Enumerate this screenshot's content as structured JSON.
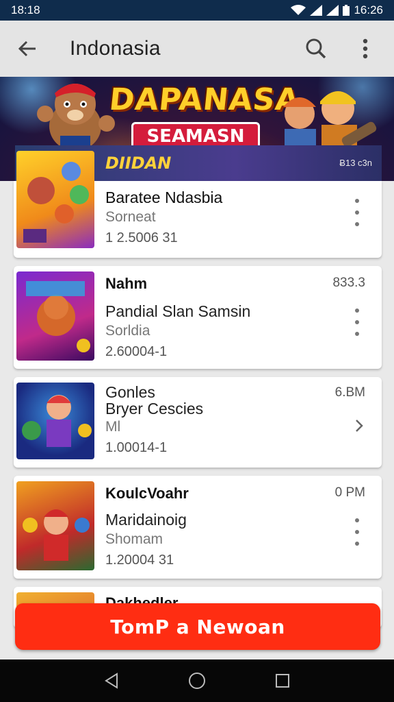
{
  "status_bar": {
    "time": "18:18",
    "right_time": "16:26"
  },
  "app_bar": {
    "title": "Indonasia",
    "back_icon": "arrow-left-icon",
    "search_icon": "search-icon",
    "menu_icon": "more-vert-icon"
  },
  "banner": {
    "title": "DAPANASA",
    "subtitle": "SEAMASN",
    "strip_title": "DIIDAN",
    "strip_right": "Ƀ13 c3n"
  },
  "cards": [
    {
      "title": "Baratee Ndasbia",
      "line2": "Sorneat",
      "line3": "1 2.5006 31",
      "meta": "",
      "action": "more-vert-icon"
    },
    {
      "title": "Nahm",
      "line2": "Pandial Slan Samsin",
      "line3": "Sorldia",
      "line4": "2.60004-1",
      "meta": "833.3",
      "action": "more-vert-icon"
    },
    {
      "title": "Gonles",
      "line2": "Bryer Cescies",
      "line3": "Ml",
      "line4": "1.00014-1",
      "meta": "6.BM",
      "action": "chevron-right-icon"
    },
    {
      "title": "KoulcVoahr",
      "line2": "Maridainoig",
      "line3": "Shomam",
      "line4": "1.20004 31",
      "meta": "0 PM",
      "action": "more-vert-icon"
    },
    {
      "title": "Dakhedler"
    }
  ],
  "cta": {
    "label": "TomP a Newoan"
  },
  "colors": {
    "accent": "#ff2d12",
    "status_bar": "#0f2c4c",
    "app_bar": "#e4e4e4"
  }
}
